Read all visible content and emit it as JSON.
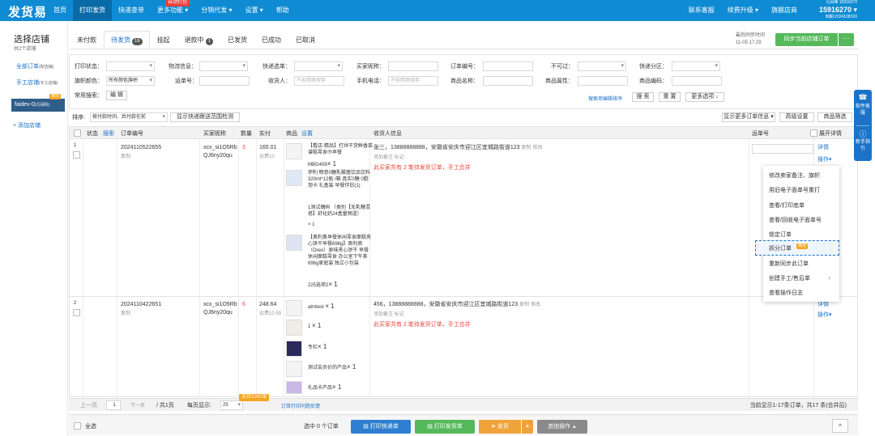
{
  "app": {
    "logo": "发货易"
  },
  "nav": {
    "items": [
      {
        "label": "首页"
      },
      {
        "label": "打印发货"
      },
      {
        "label": "快递查单"
      },
      {
        "label": "更多功能 ▾",
        "badge": "自动打包"
      },
      {
        "label": "分销代发 ▾"
      },
      {
        "label": "设置 ▾"
      },
      {
        "label": "帮助"
      }
    ],
    "right": [
      {
        "label": "联系客服"
      },
      {
        "label": "续费升级 ▾"
      },
      {
        "label": "旗舰店商"
      }
    ]
  },
  "user": {
    "line1": "凡闲峰 15916270",
    "id": "15916270 ▾",
    "line3": "到期:2024108100"
  },
  "sidebar": {
    "title": "选择店铺",
    "subtitle": "共2个店铺",
    "items": [
      {
        "label": "全部订单",
        "note": "(默选铺)"
      },
      {
        "label": "手工店铺",
        "note": "(手工店铺)"
      }
    ],
    "shop": {
      "label": "faidev-0",
      "note": "(凡闲科)",
      "tag": "离线"
    },
    "add": "+ 添加店铺"
  },
  "tabs": [
    {
      "label": "未付款"
    },
    {
      "label": "待发货",
      "count": "16"
    },
    {
      "label": "挂起"
    },
    {
      "label": "退款中",
      "count": "1"
    },
    {
      "label": "已发货"
    },
    {
      "label": "已成功"
    },
    {
      "label": "已取消"
    }
  ],
  "sync": {
    "label": "最后同步时间",
    "time": "11-05 17:29",
    "button": "同步当前店铺订单",
    "more": "···"
  },
  "filters": {
    "print_status": "打印状态：",
    "logistics": "物流信息：",
    "express_select": "快递选单：",
    "buyer_name": "买家昵称：",
    "order_no": "订单编号：",
    "not_pass": "不可过：",
    "express_zone": "快递分区：",
    "flag_color": "旗帜颜色：",
    "flag_value": "所有颜色旗帜",
    "waybill_no": "运单号：",
    "receiver": "收货人：",
    "receiver_ph": "不能精确搜索",
    "phone": "手机电话：",
    "phone_ph": "不能精确搜索",
    "product_name": "商品名称：",
    "product_attr": "商品属性：",
    "product_code": "商品编码：",
    "common_search": "常用搜索：",
    "edit": "编 辑",
    "search_link": "搜索项编辑排序",
    "search_btn": "搜 索",
    "reset_btn": "重 置",
    "more_btn": "更多选项 ↓"
  },
  "sortbar": {
    "label": "排序:",
    "sort_value": "按付款时间、后付款在前",
    "quick_btn": "显示快递跟送范围检测",
    "more_info": "显示更多订单信息 ▾",
    "adv": "高级设置",
    "filter": "商品筛选"
  },
  "table": {
    "headers": [
      "状态",
      "搜索",
      "订单编号",
      "买家昵称",
      "数量",
      "实付",
      "商品",
      "设置",
      "收货人信息",
      "运单号",
      "展开详情"
    ]
  },
  "orders": [
    {
      "idx": "1",
      "order_no": "2024110522655",
      "copy": "复制",
      "buyer": "xcx_si1O5RbQJ6ny20qu",
      "qty": "3",
      "paid": "165.01",
      "ship": "运费10",
      "receiver": "张三，13888888888，安徽省安庆市迎江区宜城路街道123",
      "copy2": "复制",
      "edit": "修改",
      "note_add": "添加备注",
      "flag": "标记",
      "warn": "此买家共有 2 笔待发货订单，手工合并",
      "detail": "详情",
      "ops": "操作▾",
      "products": [
        {
          "title": "【看店-精品】打烊干货鲜香菜谱糕零食巾早餐",
          "code": "MBG408",
          "qty": "× 1"
        },
        {
          "title": "伊利 畅意0糖乳酸菌饮品饮料 320ml*12瓶 /箱 真实0糖 0脂饱卡 礼盒装 早餐伴侣(1)",
          "code": "1测试偶码 （类别【无乳糖混搭】舒化奶24盒量频道）",
          "qty": "× 1"
        },
        {
          "title": "【奥利奥早餐休闲零食面糕夹心饼干早餐696g】奥利奥（Oreo）原味夹心饼干 早餐休闲面糕零食 办公室下午茶 696g家庭装 独立小包装",
          "code": "225选项2",
          "qty": "× 1"
        }
      ]
    },
    {
      "idx": "2",
      "order_no": "2024110422651",
      "copy": "复制",
      "buyer": "xcx_si1O5RbQJ6ny20qu",
      "qty": "6",
      "paid": "248.64",
      "ship": "运费10.59",
      "receiver": "456，13888888888，安徽省安庆市迎江区宜城路街道123",
      "copy2": "复制",
      "edit": "修改",
      "note_add": "添加备注",
      "flag": "标记",
      "warn": "此买家共有 2 笔待发货订单，手工合并",
      "detail": "详情",
      "ops": "操作▾",
      "products": [
        {
          "title": "atmtest",
          "qty": "× 1"
        },
        {
          "title": "1",
          "qty": "× 1"
        },
        {
          "title": "专栏",
          "qty": "× 1"
        },
        {
          "title": "测试会员价的产品",
          "qty": "× 1"
        },
        {
          "title": "礼品卡产品",
          "qty": "× 1"
        }
      ]
    }
  ],
  "menu": {
    "items": [
      "修改卖家备注、旗帜",
      "用旧电子面单号重打",
      "查看/打印底单",
      "查看/回收电子面单号",
      "锁定订单",
      "拆分订单",
      "重新同步此订单",
      "创建手工/售后单",
      "查看操作日志"
    ],
    "split_tag": "离线",
    "arrow": "›"
  },
  "pager": {
    "prev": "上一页",
    "page": "1",
    "next": "下一页",
    "total": "/ 共1页",
    "per_label": "每页显示:",
    "per": "25",
    "tip": "支持1000单",
    "link": "订单打印问题反馈",
    "summary": "当前显示1-17条订单，共17 条(合并后)"
  },
  "footer": {
    "select_all": "全选",
    "selected": "选中 0 个订单",
    "print_express": "打印快递单",
    "print_ship": "打印发货单",
    "ship": "发货",
    "other": "其他操作",
    "up": "^"
  },
  "float": {
    "a": "软件客服",
    "b": "新手指引"
  }
}
